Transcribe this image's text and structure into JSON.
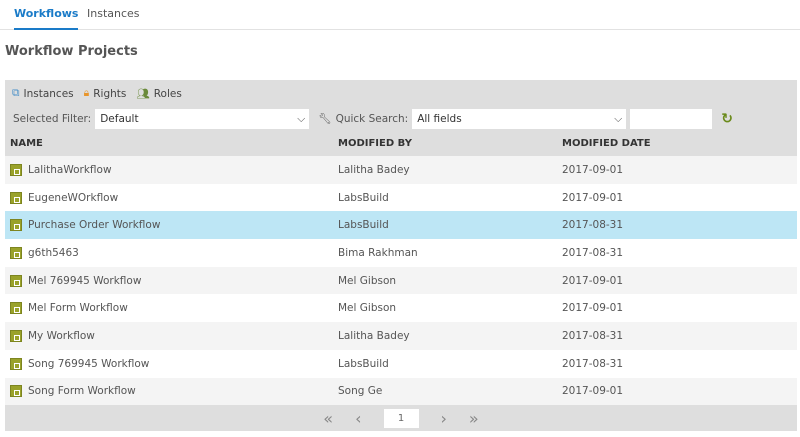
{
  "tabs": [
    {
      "label": "Workflows"
    },
    {
      "label": "Instances"
    }
  ],
  "title": "Workflow Projects",
  "toolbar": {
    "instances": "Instances",
    "rights": "Rights",
    "roles": "Roles"
  },
  "filter": {
    "label": "Selected Filter:",
    "value": "Default",
    "quick_label": "Quick Search:",
    "quick_value": "All fields",
    "search_value": ""
  },
  "columns": [
    "NAME",
    "MODIFIED BY",
    "MODIFIED DATE"
  ],
  "rows": [
    [
      "LalithaWorkflow",
      "Lalitha Badey",
      "2017-09-01"
    ],
    [
      "EugeneWOrkflow",
      "LabsBuild",
      "2017-09-01"
    ],
    [
      "Purchase Order Workflow",
      "LabsBuild",
      "2017-08-31"
    ],
    [
      "g6th5463",
      "Bima Rakhman",
      "2017-08-31"
    ],
    [
      "Mel 769945 Workflow",
      "Mel Gibson",
      "2017-09-01"
    ],
    [
      "Mel Form Workflow",
      "Mel Gibson",
      "2017-09-01"
    ],
    [
      "My Workflow",
      "Lalitha Badey",
      "2017-08-31"
    ],
    [
      "Song 769945 Workflow",
      "LabsBuild",
      "2017-08-31"
    ],
    [
      "Song Form Workflow",
      "Song Ge",
      "2017-09-01"
    ]
  ],
  "selected_row": 2,
  "pager": {
    "page": "1",
    "first": "«",
    "prev": "‹",
    "next": "›",
    "last": "»"
  }
}
